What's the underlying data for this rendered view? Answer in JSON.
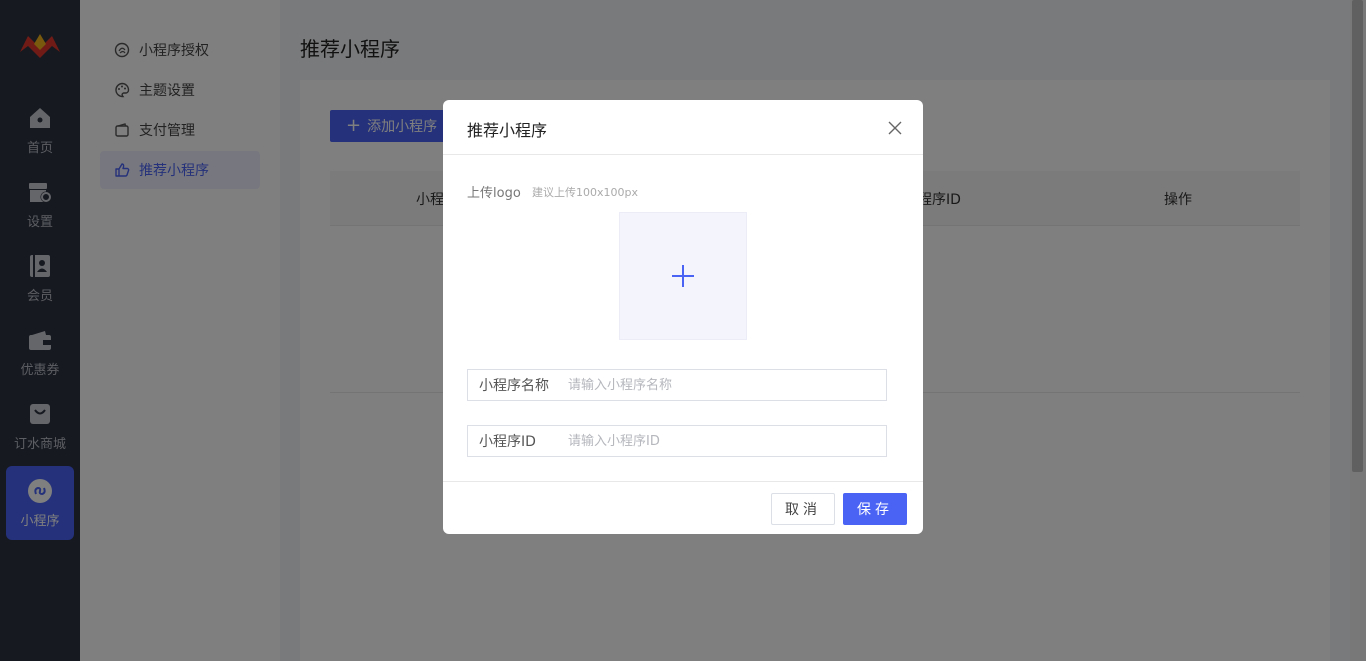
{
  "nav": {
    "items": [
      {
        "label": "首页",
        "icon": "home-icon"
      },
      {
        "label": "设置",
        "icon": "store-settings-icon"
      },
      {
        "label": "会员",
        "icon": "member-icon"
      },
      {
        "label": "优惠券",
        "icon": "wallet-icon"
      },
      {
        "label": "订水商城",
        "icon": "shopping-bag-icon"
      },
      {
        "label": "小程序",
        "icon": "mini-program-icon"
      }
    ],
    "active_index": 5,
    "accent": "#4a63f5"
  },
  "submenu": {
    "items": [
      {
        "label": "小程序授权",
        "icon": "authorize-icon"
      },
      {
        "label": "主题设置",
        "icon": "palette-icon"
      },
      {
        "label": "支付管理",
        "icon": "wallet-icon"
      },
      {
        "label": "推荐小程序",
        "icon": "thumbs-up-icon"
      }
    ],
    "active_index": 3
  },
  "main": {
    "page_title": "推荐小程序",
    "add_button": "添加小程序",
    "columns": [
      "小程",
      "程序ID",
      "操作"
    ]
  },
  "dialog": {
    "title": "推荐小程序",
    "upload_label": "上传logo",
    "upload_hint": "建议上传100x100px",
    "name_label": "小程序名称",
    "name_placeholder": "请输入小程序名称",
    "name_value": "",
    "id_label": "小程序ID",
    "id_placeholder": "请输入小程序ID",
    "id_value": "",
    "cancel": "取消",
    "save": "保存"
  }
}
